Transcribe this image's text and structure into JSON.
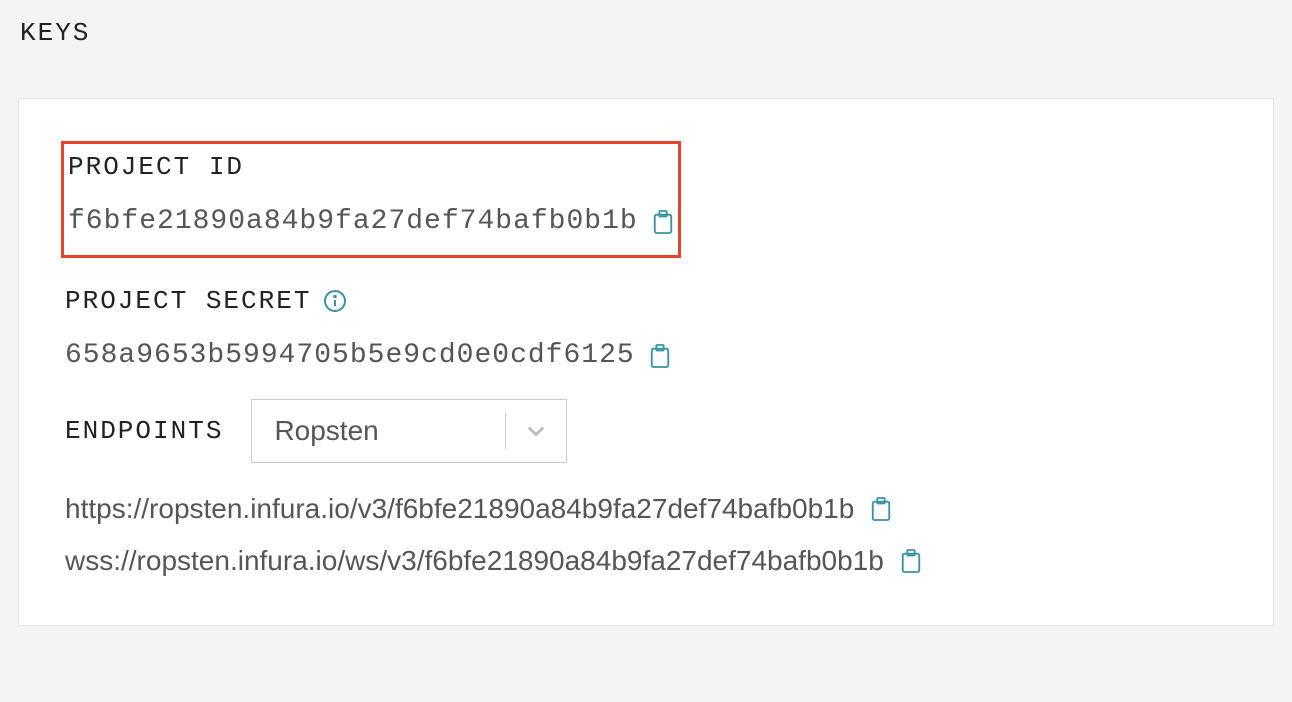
{
  "section_title": "KEYS",
  "project_id": {
    "label": "PROJECT ID",
    "value": "f6bfe21890a84b9fa27def74bafb0b1b"
  },
  "project_secret": {
    "label": "PROJECT SECRET",
    "value": "658a9653b5994705b5e9cd0e0cdf6125"
  },
  "endpoints": {
    "label": "ENDPOINTS",
    "selected": "Ropsten",
    "http_url": "https://ropsten.infura.io/v3/f6bfe21890a84b9fa27def74bafb0b1b",
    "wss_url": "wss://ropsten.infura.io/ws/v3/f6bfe21890a84b9fa27def74bafb0b1b"
  },
  "colors": {
    "highlight": "#e7432c",
    "icon_teal": "#3a92a0"
  }
}
